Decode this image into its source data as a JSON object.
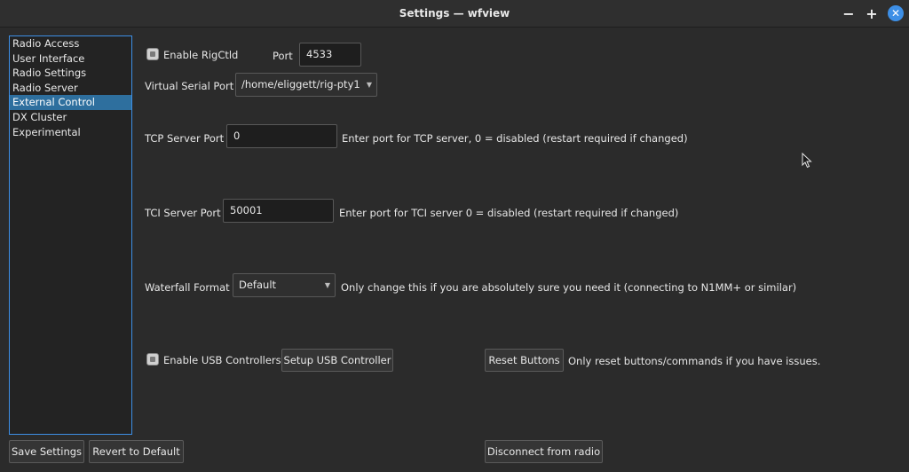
{
  "window": {
    "title": "Settings — wfview",
    "minimize": "−",
    "maximize": "+",
    "close": "✕"
  },
  "sidebar": {
    "items": [
      {
        "label": "Radio Access",
        "selected": false
      },
      {
        "label": "User Interface",
        "selected": false
      },
      {
        "label": "Radio Settings",
        "selected": false
      },
      {
        "label": "Radio Server",
        "selected": false
      },
      {
        "label": "External Control",
        "selected": true
      },
      {
        "label": "DX Cluster",
        "selected": false
      },
      {
        "label": "Experimental",
        "selected": false
      }
    ]
  },
  "rigctld": {
    "enable_label": "Enable RigCtld",
    "enabled": false,
    "port_label": "Port",
    "port_value": "4533",
    "virtual_serial_label": "Virtual Serial Port",
    "virtual_serial_value": "/home/eliggett/rig-pty1"
  },
  "tcp": {
    "label": "TCP Server Port",
    "value": "0",
    "hint": "Enter port for TCP server, 0 = disabled (restart required if changed)"
  },
  "tci": {
    "label": "TCI Server Port",
    "value": "50001",
    "hint": "Enter port for TCI server 0 = disabled (restart required if changed)"
  },
  "waterfall": {
    "label": "Waterfall Format",
    "value": "Default",
    "hint": "Only change this if you are absolutely sure you need it (connecting to N1MM+ or similar)"
  },
  "usb": {
    "enable_label": "Enable USB Controllers",
    "enabled": false,
    "setup_button": "Setup USB Controller",
    "reset_button": "Reset Buttons",
    "reset_hint": "Only reset buttons/commands if you have issues."
  },
  "footer": {
    "save_button": "Save Settings",
    "revert_button": "Revert to Default",
    "disconnect_button": "Disconnect from radio"
  },
  "colors": {
    "accent": "#3d8fe6",
    "selection": "#2e6f9e",
    "background": "#2b2b2b"
  }
}
